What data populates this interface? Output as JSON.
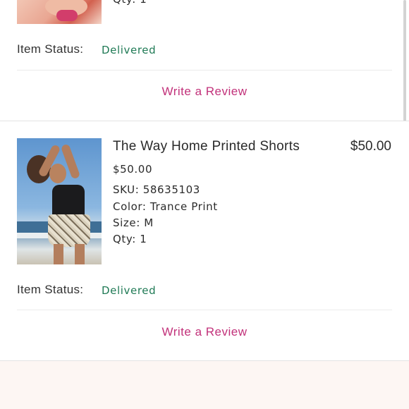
{
  "order_items": [
    {
      "details": {
        "qty": "Qty: 1"
      },
      "status": {
        "label": "Item Status:",
        "value": "Delivered"
      },
      "review_link": "Write a Review"
    },
    {
      "title": "The Way Home Printed Shorts",
      "price": "$50.00",
      "details": {
        "unit_price": "$50.00",
        "sku": "SKU: 58635103",
        "color": "Color: Trance Print",
        "size": "Size: M",
        "qty": "Qty: 1"
      },
      "status": {
        "label": "Item Status:",
        "value": "Delivered"
      },
      "review_link": "Write a Review"
    }
  ],
  "colors": {
    "status_delivered": "#1f7a55",
    "review_link": "#c2317a",
    "footer_background": "#fdf6f3"
  }
}
